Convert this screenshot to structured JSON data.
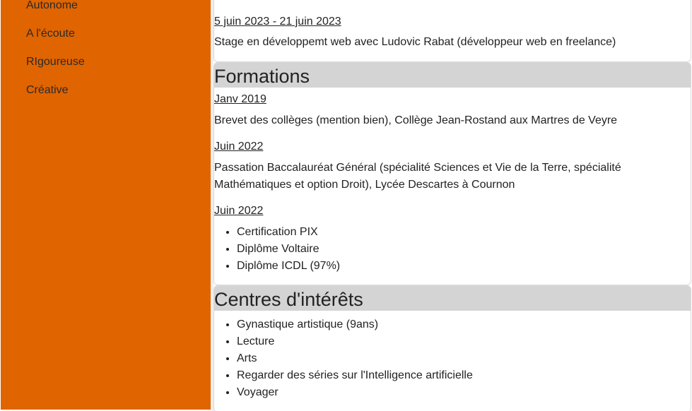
{
  "sidebar": {
    "skills": [
      "Autonome",
      "A l'écoute",
      "RIgoureuse",
      "Créative"
    ]
  },
  "experience": {
    "date": "5 juin 2023 - 21 juin 2023",
    "description": "Stage en développemt web avec Ludovic Rabat (développeur web en freelance)"
  },
  "formations": {
    "title": "Formations",
    "entries": [
      {
        "date": "Janv 2019",
        "description": "Brevet des collèges (mention bien), Collège Jean-Rostand aux Martres de Veyre"
      },
      {
        "date": "Juin 2022",
        "description_line1": "Passation Baccalauréat Général (spécialité Sciences et Vie de la Terre, spécialité",
        "description_line2": "Mathématiques et option Droit), Lycée Descartes à Cournon"
      },
      {
        "date": "Juin 2022",
        "items": [
          "Certification PIX",
          "Diplôme Voltaire",
          "Diplôme ICDL (97%)"
        ]
      }
    ]
  },
  "interets": {
    "title": "Centres d'intérêts",
    "items": [
      "Gynastique artistique (9ans)",
      "Lecture",
      "Arts",
      "Regarder des séries sur l'Intelligence artificielle",
      "Voyager"
    ]
  }
}
